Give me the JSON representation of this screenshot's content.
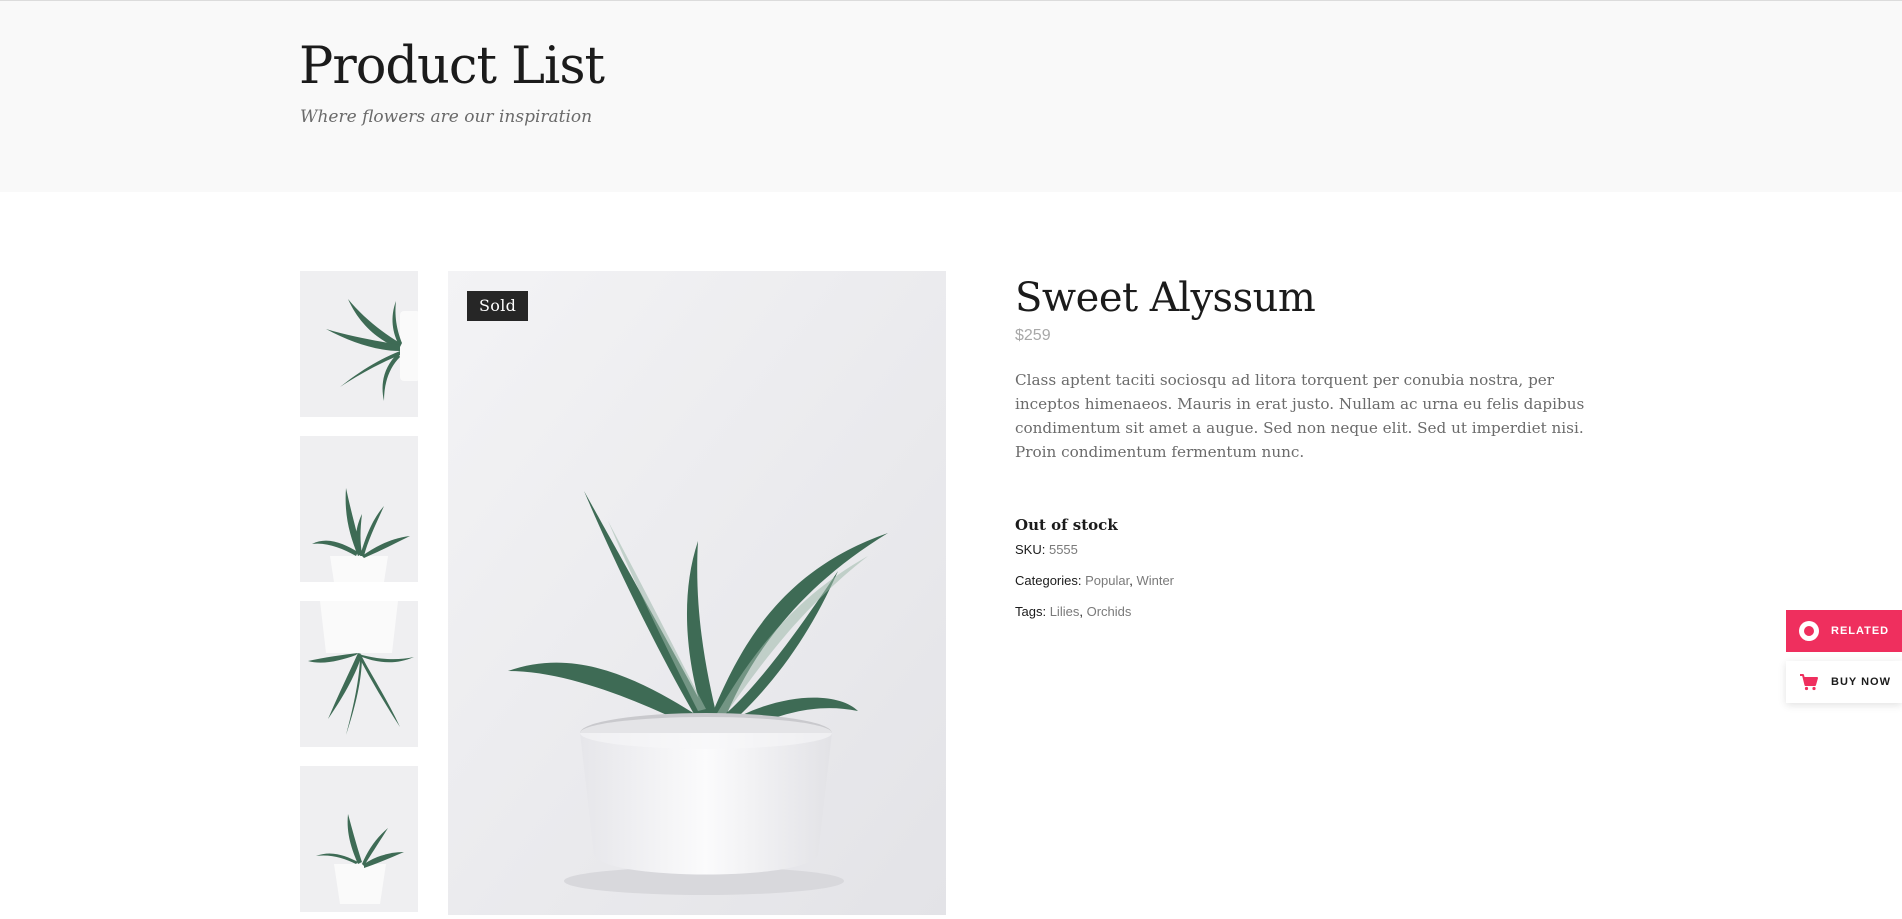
{
  "header": {
    "title": "Product List",
    "subtitle": "Where flowers are our inspiration"
  },
  "gallery": {
    "badge": "Sold",
    "thumbnails": [
      {
        "icon": "plant-sideways-image"
      },
      {
        "icon": "plant-pot-image"
      },
      {
        "icon": "plant-upside-down-image"
      },
      {
        "icon": "plant-pot-small-image"
      }
    ]
  },
  "product": {
    "title": "Sweet Alyssum",
    "price": "$259",
    "description": "Class aptent taciti sociosqu ad litora torquent per conubia nostra, per inceptos himenaeos. Mauris in erat justo. Nullam ac urna eu felis dapibus condimentum sit amet a augue. Sed non neque elit. Sed ut imperdiet nisi. Proin condimentum fermentum nunc.",
    "stock": "Out of stock",
    "sku_label": "SKU:",
    "sku_value": "5555",
    "categories_label": "Categories:",
    "categories": [
      "Popular",
      "Winter"
    ],
    "tags_label": "Tags:",
    "tags": [
      "Lilies",
      "Orchids"
    ],
    "separator": ","
  },
  "floating": {
    "related_label": "RELATED",
    "buy_label": "BUY NOW"
  },
  "colors": {
    "accent": "#ef2f5e",
    "badge": "#262626",
    "header_bg": "#f9f9f9",
    "leaf": "#3e6b55"
  }
}
